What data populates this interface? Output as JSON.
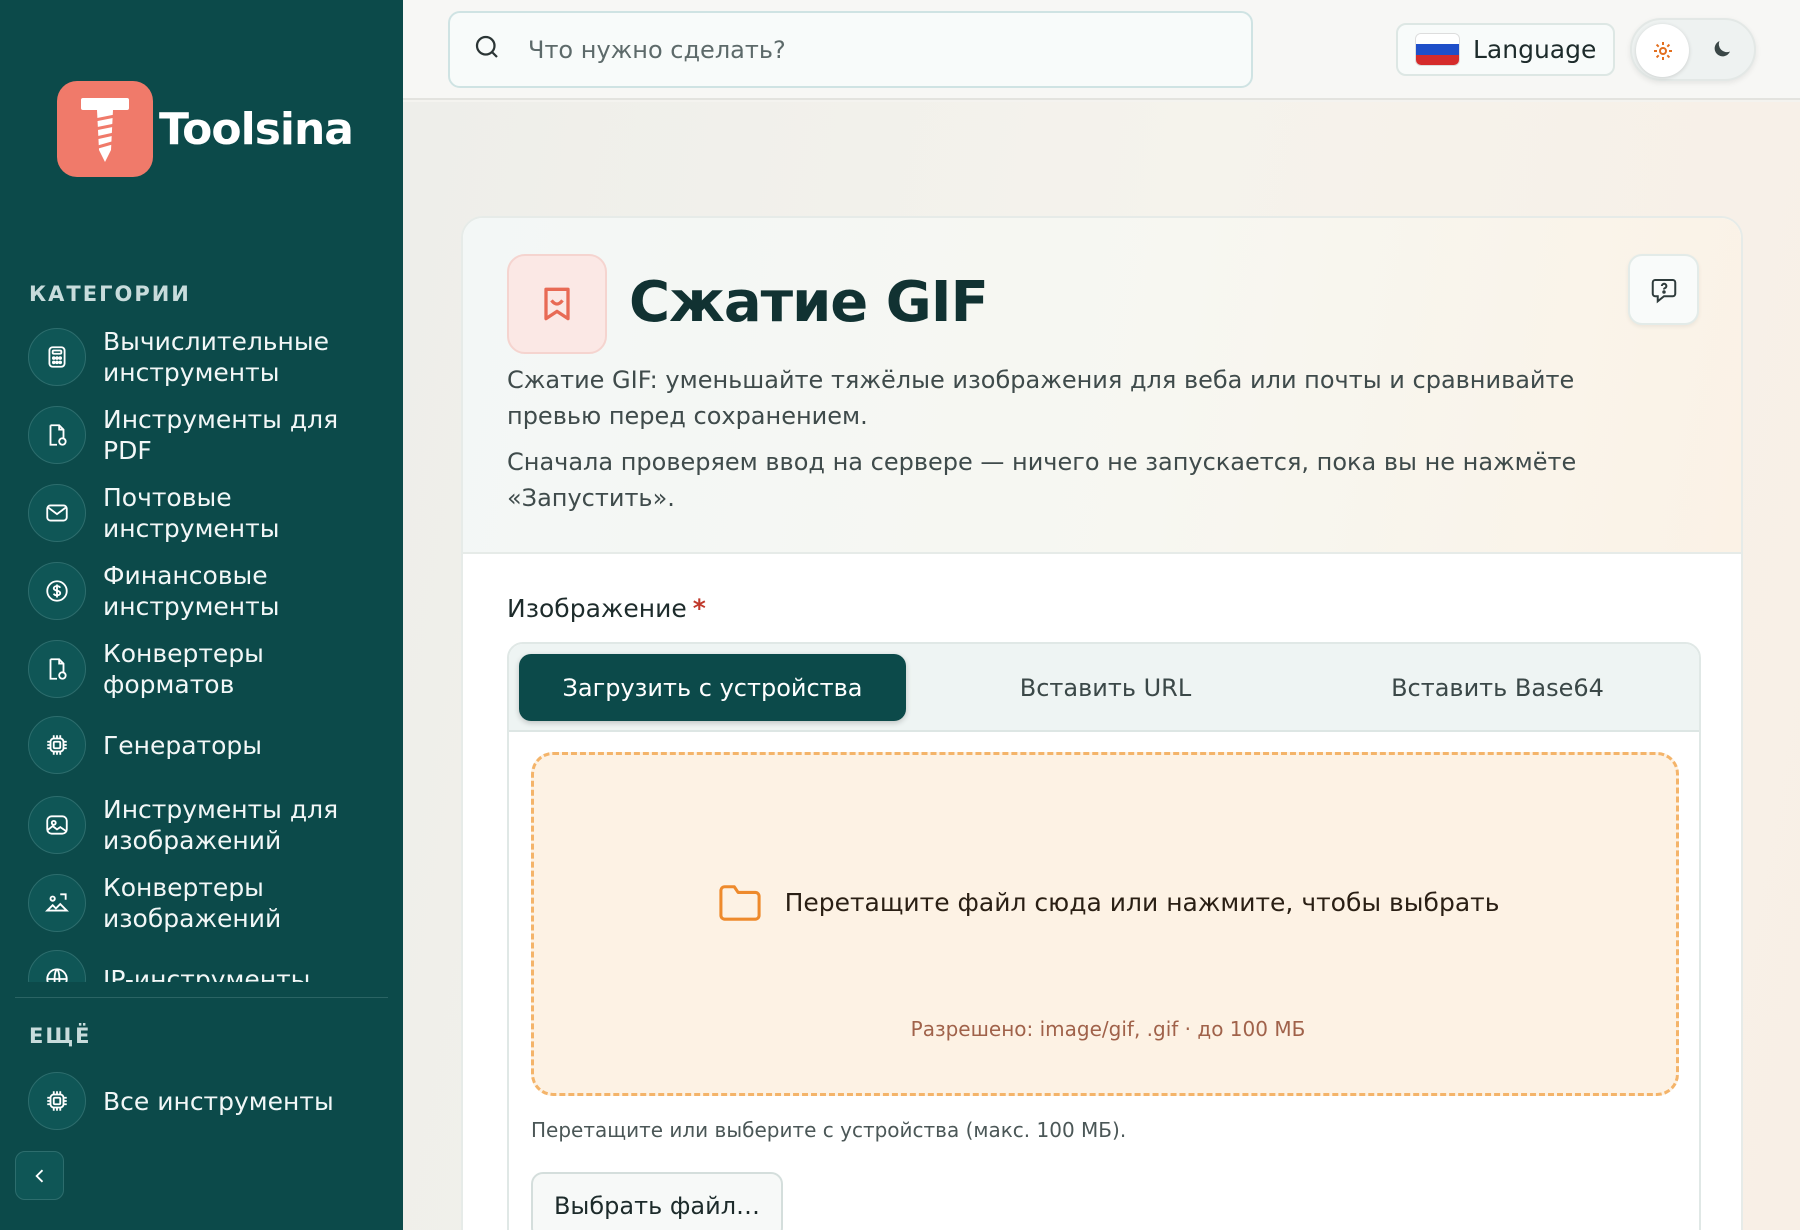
{
  "brand": {
    "name": "Toolsina"
  },
  "sidebar": {
    "categories_label": "КАТЕГОРИИ",
    "items": [
      {
        "label": "Вычислительные инструменты",
        "icon": "calculator-icon"
      },
      {
        "label": "Инструменты для PDF",
        "icon": "document-icon"
      },
      {
        "label": "Почтовые инструменты",
        "icon": "mail-icon"
      },
      {
        "label": "Финансовые инструменты",
        "icon": "dollar-icon"
      },
      {
        "label": "Конвертеры форматов",
        "icon": "convert-icon"
      },
      {
        "label": "Генераторы",
        "icon": "chip-icon"
      },
      {
        "label": "Инструменты для изображений",
        "icon": "image-icon"
      },
      {
        "label": "Конвертеры изображений",
        "icon": "image-convert-icon"
      },
      {
        "label": "IP-инструменты",
        "icon": "network-icon"
      }
    ],
    "more_label": "ЕЩЁ",
    "all_tools_label": "Все инструменты"
  },
  "topbar": {
    "search_placeholder": "Что нужно сделать?",
    "language_label": "Language"
  },
  "tool": {
    "title": "Сжатие GIF",
    "description_1": "Сжатие GIF: уменьшайте тяжёлые изображения для веба или почты и сравнивайте превью перед сохранением.",
    "description_2": "Сначала проверяем ввод на сервере — ничего не запускается, пока вы не нажмёте «Запустить».",
    "field_label": "Изображение",
    "required_mark": "*",
    "tabs": [
      {
        "label": "Загрузить с устройства",
        "active": true
      },
      {
        "label": "Вставить URL",
        "active": false
      },
      {
        "label": "Вставить Base64",
        "active": false
      }
    ],
    "dropzone_text": "Перетащите файл сюда или нажмите, чтобы выбрать",
    "dropzone_hint": "Разрешено: image/gif, .gif · до 100 МБ",
    "helper_text": "Перетащите или выберите с устройства (макс. 100 МБ).",
    "choose_button": "Выбрать файл…"
  },
  "colors": {
    "sidebar_bg": "#0c4a4a",
    "brand_accent": "#f07a6a",
    "dropzone_border": "#f4b46a"
  }
}
